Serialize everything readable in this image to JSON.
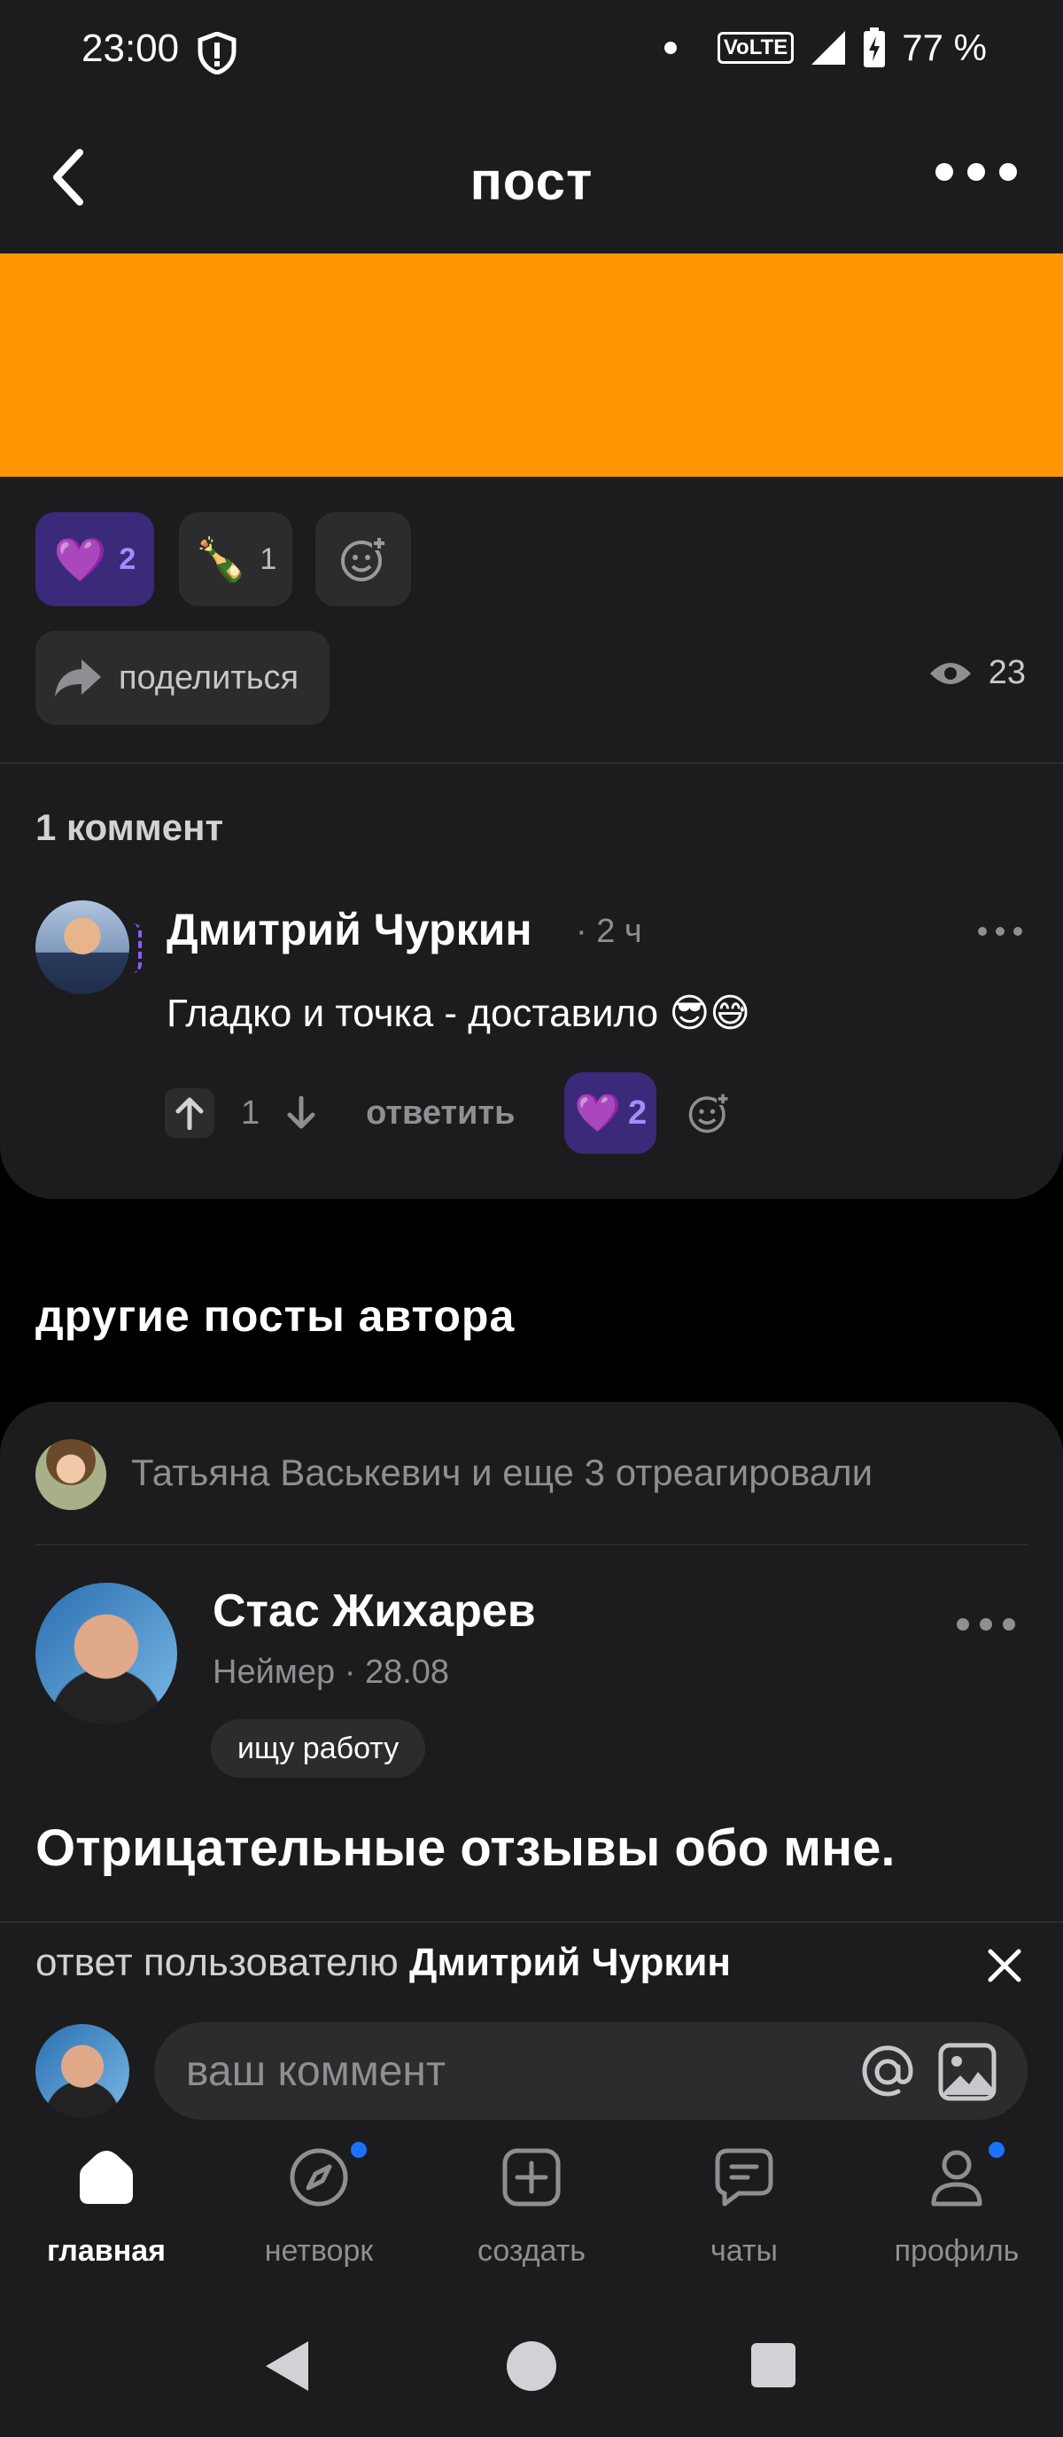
{
  "status_bar": {
    "time": "23:00",
    "battery": "77 %",
    "network": "VoLTE"
  },
  "header": {
    "title": "пост"
  },
  "post": {
    "reactions": [
      {
        "emoji": "💜",
        "count": "2",
        "active": true
      },
      {
        "emoji": "🍾",
        "count": "1",
        "active": false
      }
    ],
    "share_label": "поделиться",
    "views": "23"
  },
  "comments": {
    "count_label": "1 коммент",
    "items": [
      {
        "author": "Дмитрий Чуркин",
        "time": "· 2 ч",
        "text": "Гладко и точка - доставило 😎😅",
        "votes": "1",
        "reply_label": "ответить",
        "reaction_emoji": "💜",
        "reaction_count": "2"
      }
    ]
  },
  "other_posts": {
    "section_title": "другие посты автора",
    "reacted_text": "Татьяна Васькевич и еще 3 отреагировали",
    "author": "Стас Жихарев",
    "meta": "Неймер · 28.08",
    "status": "ищу работу",
    "title": "Отрицательные отзывы обо мне."
  },
  "reply_bar": {
    "prefix": "ответ пользователю",
    "target": "Дмитрий Чуркин",
    "placeholder": "ваш коммент"
  },
  "nav": {
    "items": [
      {
        "label": "главная",
        "active": true
      },
      {
        "label": "нетворк",
        "active": false
      },
      {
        "label": "создать",
        "active": false
      },
      {
        "label": "чаты",
        "active": false
      },
      {
        "label": "профиль",
        "active": false
      }
    ]
  }
}
